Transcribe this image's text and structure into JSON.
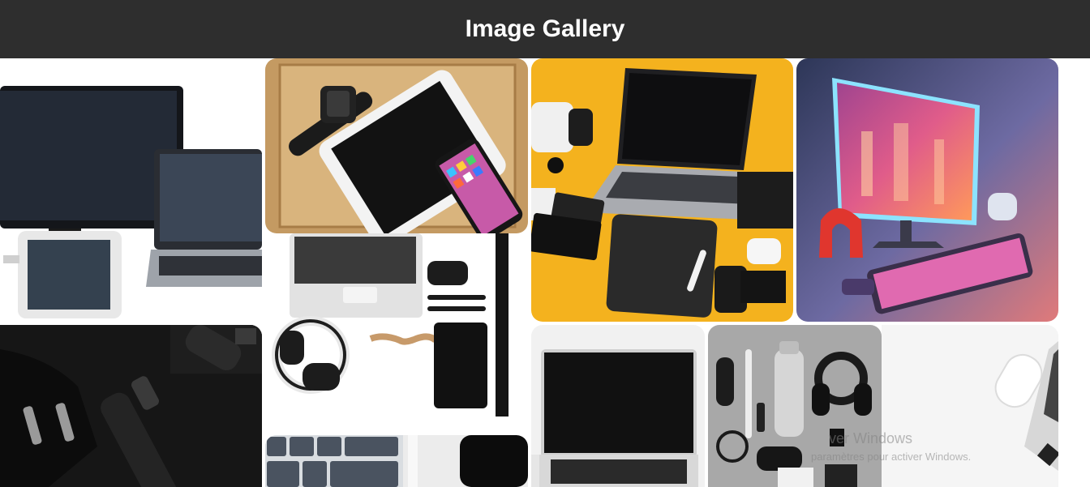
{
  "header": {
    "title": "Image Gallery"
  },
  "gallery": {
    "images": [
      {
        "subject": "monitor-laptop-tablet"
      },
      {
        "subject": "tablet-watch-phone-on-wood"
      },
      {
        "subject": "laptop-gadgets-on-yellow"
      },
      {
        "subject": "neon-gaming-setup"
      },
      {
        "subject": "charger-and-pen-on-black"
      },
      {
        "subject": "keyboard-headphones-accessories"
      },
      {
        "subject": "keyboard-closeup"
      },
      {
        "subject": "laptop-on-white"
      },
      {
        "subject": "gadgets-on-grey-concrete"
      },
      {
        "subject": "laptop-mouse-on-white"
      }
    ]
  },
  "watermark": {
    "line1": "ver Windows",
    "line2": "paramètres pour activer Windows."
  }
}
